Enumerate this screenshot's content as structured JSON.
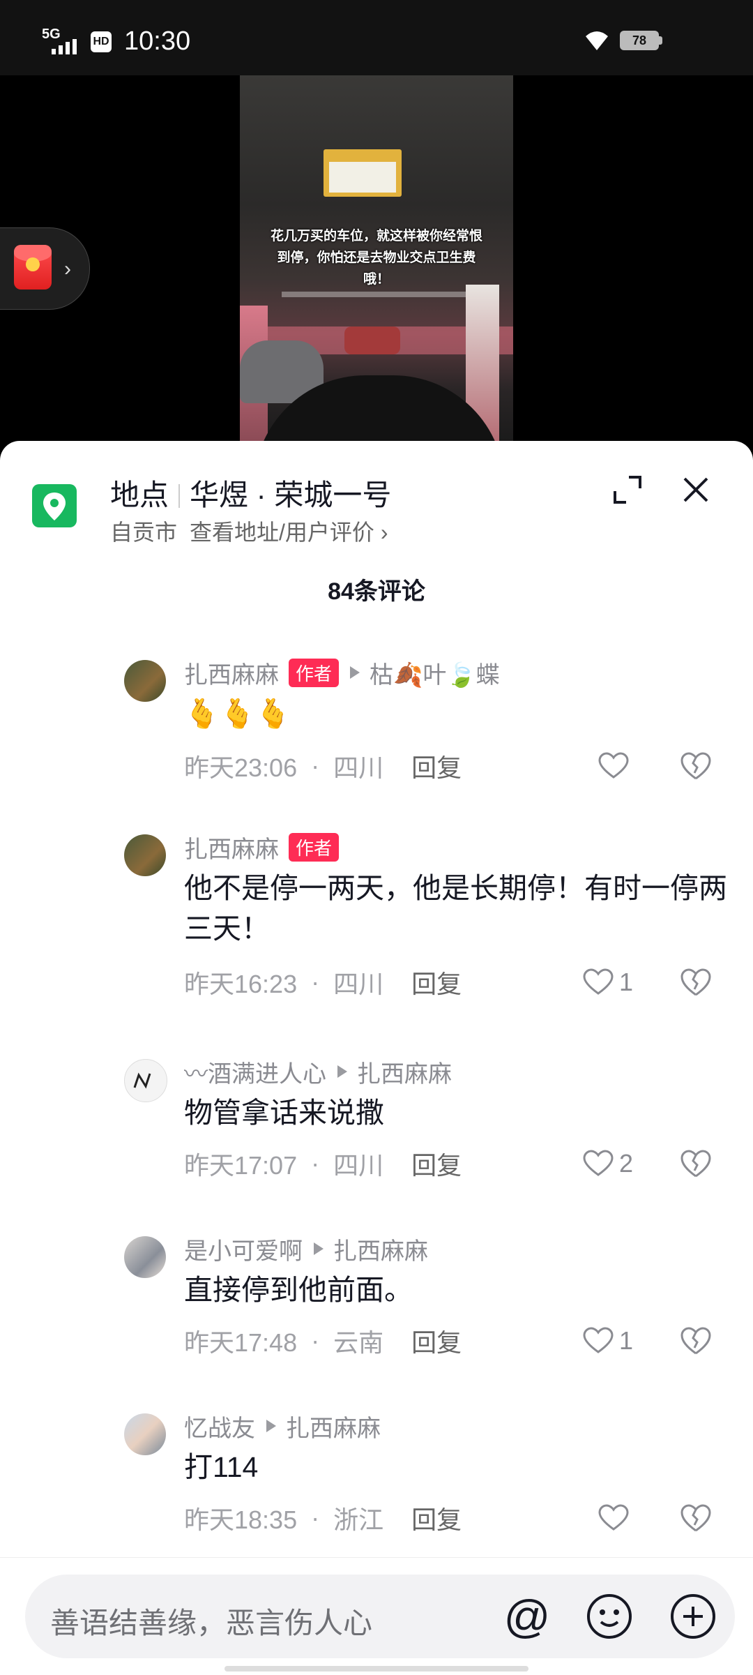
{
  "status_bar": {
    "network": "5G",
    "hd": "HD",
    "time": "10:30",
    "battery": "78"
  },
  "video": {
    "caption": "花几万买的车位，就这样被你经常恨到停，你怕还是去物业交点卫生费哦！"
  },
  "location": {
    "label": "地点",
    "name": "华煜 · 荣城一号",
    "city": "自贡市",
    "link": "查看地址/用户评价",
    "chevron": "›"
  },
  "comments_count": "84条评论",
  "comments": [
    {
      "user": "扎西麻麻",
      "badge": "作者",
      "reply_to": "枯🍂叶🍃蝶",
      "text": "🫰🫰🫰",
      "time": "昨天23:06",
      "region": "四川",
      "reply_label": "回复",
      "likes": ""
    },
    {
      "user": "扎西麻麻",
      "badge": "作者",
      "reply_to": "",
      "text": "他不是停一两天，他是长期停！有时一停两三天！",
      "time": "昨天16:23",
      "region": "四川",
      "reply_label": "回复",
      "likes": "1"
    },
    {
      "user": "〰酒满进人心",
      "badge": "",
      "reply_to": "扎西麻麻",
      "text": "物管拿话来说撒",
      "time": "昨天17:07",
      "region": "四川",
      "reply_label": "回复",
      "likes": "2"
    },
    {
      "user": "是小可爱啊",
      "badge": "",
      "reply_to": "扎西麻麻",
      "text": "直接停到他前面。",
      "time": "昨天17:48",
      "region": "云南",
      "reply_label": "回复",
      "likes": "1"
    },
    {
      "user": "忆战友",
      "badge": "",
      "reply_to": "扎西麻麻",
      "text": "打114",
      "time": "昨天18:35",
      "region": "浙江",
      "reply_label": "回复",
      "likes": ""
    }
  ],
  "input": {
    "placeholder": "善语结善缘，恶言伤人心",
    "at_symbol": "@"
  }
}
